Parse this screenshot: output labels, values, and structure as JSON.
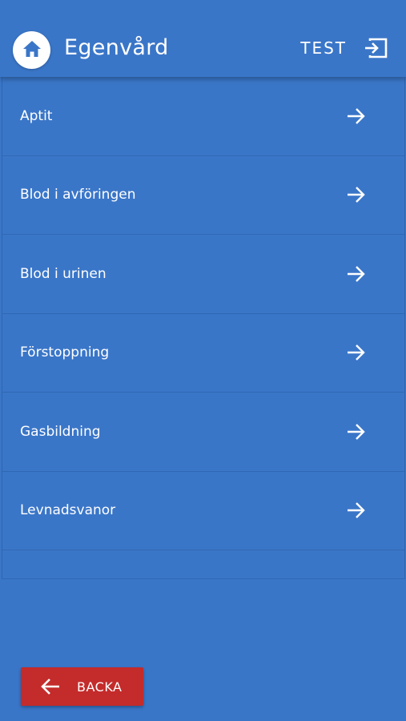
{
  "header": {
    "title": "Egenvård",
    "user_label": "TEST",
    "home_icon": "home-icon",
    "logout_icon": "logout-icon"
  },
  "list": {
    "items": [
      {
        "label": "Aptit",
        "icon": "arrow-right-icon"
      },
      {
        "label": "Blod i avföringen",
        "icon": "arrow-right-icon"
      },
      {
        "label": "Blod i urinen",
        "icon": "arrow-right-icon"
      },
      {
        "label": "Förstoppning",
        "icon": "arrow-right-icon"
      },
      {
        "label": "Gasbildning",
        "icon": "arrow-right-icon"
      },
      {
        "label": "Levnadsvanor",
        "icon": "arrow-right-icon"
      }
    ]
  },
  "back_button": {
    "label": "BACKA",
    "icon": "arrow-left-icon"
  },
  "colors": {
    "background": "#3a76c8",
    "back_button": "#c42b2b",
    "text": "#ffffff"
  }
}
